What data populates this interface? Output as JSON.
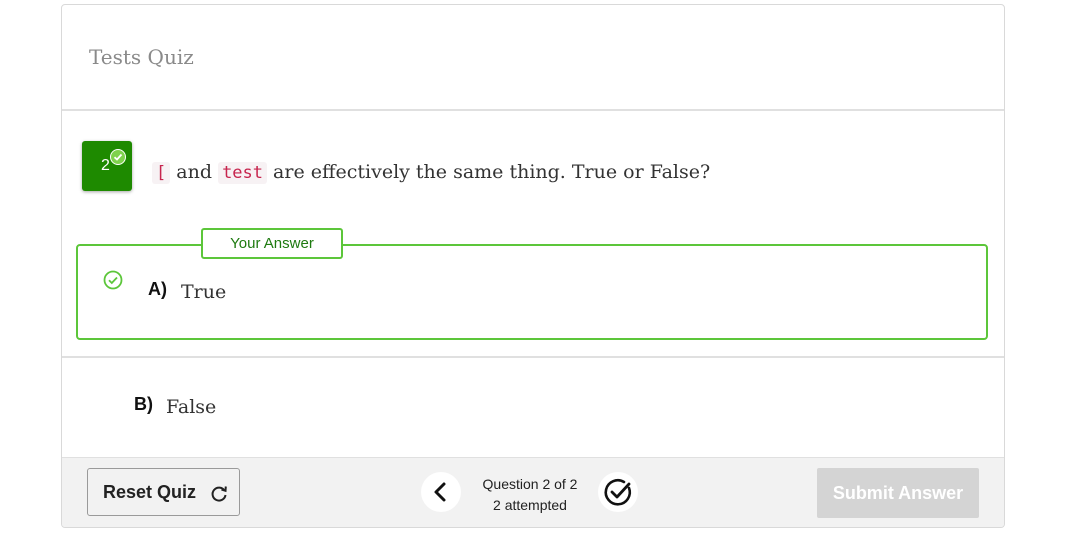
{
  "quiz": {
    "title": "Tests Quiz"
  },
  "question": {
    "number": "2",
    "code1": "[",
    "text1": " and ",
    "code2": "test",
    "text2": " are effectively the same thing. True or False?"
  },
  "your_answer_label": "Your Answer",
  "options": [
    {
      "letter": "A)",
      "text": "True"
    },
    {
      "letter": "B)",
      "text": "False"
    }
  ],
  "footer": {
    "reset_label": "Reset Quiz",
    "question_progress": "Question 2 of 2",
    "attempted": "2 attempted",
    "submit_label": "Submit Answer"
  },
  "colors": {
    "correct_green": "#5cc63a",
    "question_badge": "#1e8a00",
    "submit_disabled": "#d4d4d4"
  },
  "icons": [
    "check-badge-icon",
    "check-circle-icon",
    "reload-icon",
    "chevron-left-icon",
    "check-circle-outline-icon"
  ]
}
